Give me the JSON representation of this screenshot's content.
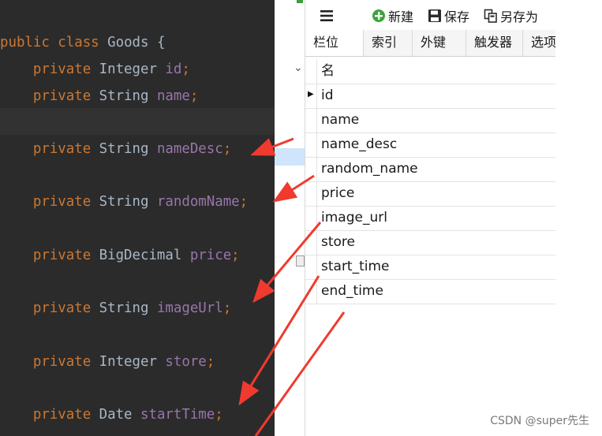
{
  "editor": {
    "lines": [
      {
        "parts": [
          {
            "t": "public",
            "c": "kw"
          },
          {
            "t": " class ",
            "c": "kw"
          },
          {
            "t": "Goods",
            "c": "ty"
          },
          {
            "t": " {",
            "c": "ty"
          }
        ]
      },
      {
        "parts": [
          {
            "t": "    private",
            "c": "kw"
          },
          {
            "t": " Integer ",
            "c": "ty"
          },
          {
            "t": "id",
            "c": "fd"
          },
          {
            "t": ";",
            "c": "pn"
          }
        ]
      },
      {
        "parts": [
          {
            "t": "    private",
            "c": "kw"
          },
          {
            "t": " String ",
            "c": "ty"
          },
          {
            "t": "name",
            "c": "fd"
          },
          {
            "t": ";",
            "c": "pn"
          }
        ]
      },
      {
        "parts": []
      },
      {
        "parts": [
          {
            "t": "    private",
            "c": "kw"
          },
          {
            "t": " String ",
            "c": "ty"
          },
          {
            "t": "nameDesc",
            "c": "fd"
          },
          {
            "t": ";",
            "c": "pn"
          }
        ]
      },
      {
        "parts": []
      },
      {
        "parts": [
          {
            "t": "    private",
            "c": "kw"
          },
          {
            "t": " String ",
            "c": "ty"
          },
          {
            "t": "randomName",
            "c": "fd"
          },
          {
            "t": ";",
            "c": "pn"
          }
        ]
      },
      {
        "parts": []
      },
      {
        "parts": [
          {
            "t": "    private",
            "c": "kw"
          },
          {
            "t": " BigDecimal ",
            "c": "ty"
          },
          {
            "t": "price",
            "c": "fd"
          },
          {
            "t": ";",
            "c": "pn"
          }
        ]
      },
      {
        "parts": []
      },
      {
        "parts": [
          {
            "t": "    private",
            "c": "kw"
          },
          {
            "t": " String ",
            "c": "ty"
          },
          {
            "t": "imageUrl",
            "c": "fd"
          },
          {
            "t": ";",
            "c": "pn"
          }
        ]
      },
      {
        "parts": []
      },
      {
        "parts": [
          {
            "t": "    private",
            "c": "kw"
          },
          {
            "t": " Integer ",
            "c": "ty"
          },
          {
            "t": "store",
            "c": "fd"
          },
          {
            "t": ";",
            "c": "pn"
          }
        ]
      },
      {
        "parts": []
      },
      {
        "parts": [
          {
            "t": "    private",
            "c": "kw"
          },
          {
            "t": " Date ",
            "c": "ty"
          },
          {
            "t": "startTime",
            "c": "fd"
          },
          {
            "t": ";",
            "c": "pn"
          }
        ]
      }
    ]
  },
  "toolbar": {
    "menu_icon": "hamburger-menu-icon",
    "new_label": "新建",
    "save_label": "保存",
    "save_as_label": "另存为"
  },
  "tabs": [
    "栏位",
    "索引",
    "外键",
    "触发器",
    "选项"
  ],
  "grid": {
    "header": "名",
    "rows": [
      "id",
      "name",
      "name_desc",
      "random_name",
      "price",
      "image_url",
      "store",
      "start_time",
      "end_time"
    ]
  },
  "watermark": "CSDN @super先生",
  "colors": {
    "editor_bg": "#2b2b2b",
    "keyword": "#cc7832",
    "type": "#a9b7c6",
    "field": "#9876aa",
    "arrow": "#f03a2f",
    "selection": "#cfe5fb"
  }
}
